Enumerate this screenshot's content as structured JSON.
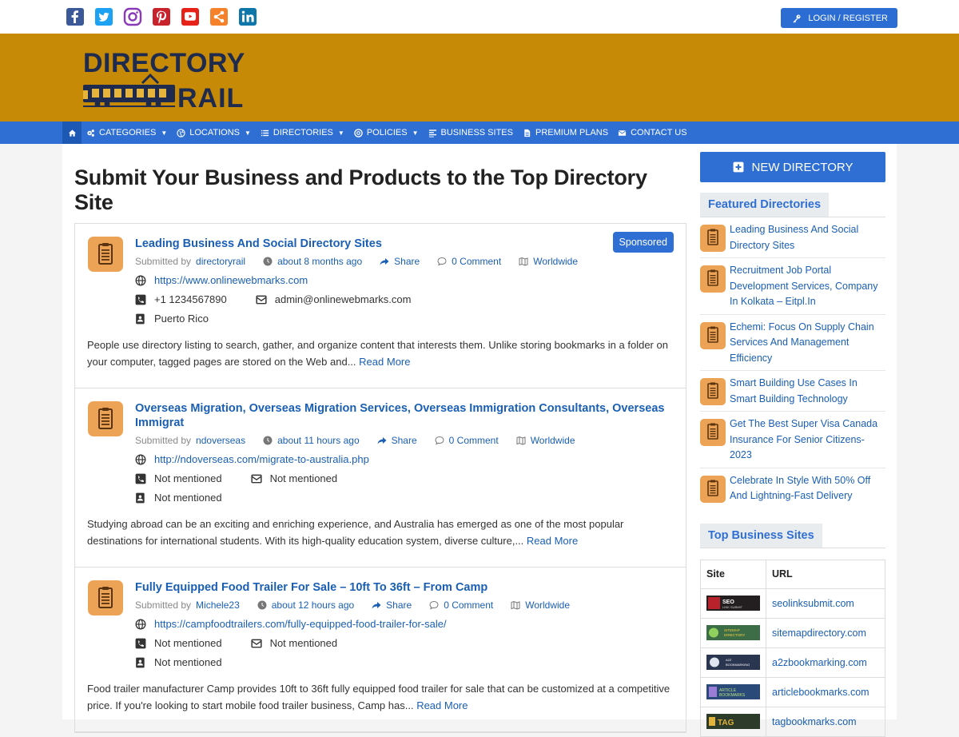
{
  "topbar": {
    "social": [
      "facebook-icon",
      "twitter-icon",
      "instagram-icon",
      "pinterest-icon",
      "youtube-icon",
      "share-icon",
      "linkedin-icon"
    ],
    "login_label": "LOGIN / REGISTER"
  },
  "logo": {
    "line1": "DIRECTORY",
    "line2": "RAIL"
  },
  "nav": {
    "items": [
      {
        "label": "CATEGORIES",
        "dropdown": true
      },
      {
        "label": "LOCATIONS",
        "dropdown": true
      },
      {
        "label": "DIRECTORIES",
        "dropdown": true
      },
      {
        "label": "POLICIES",
        "dropdown": true
      },
      {
        "label": "BUSINESS SITES",
        "dropdown": false
      },
      {
        "label": "PREMIUM PLANS",
        "dropdown": false
      },
      {
        "label": "CONTACT US",
        "dropdown": false
      }
    ]
  },
  "page": {
    "title": "Submit Your Business and Products to the Top Directory Site"
  },
  "listings": [
    {
      "title": "Leading Business And Social Directory Sites",
      "submitted_by_label": "Submitted by",
      "user": "directoryrail",
      "time": "about 8 months ago",
      "share": "Share",
      "comments": "0 Comment",
      "region": "Worldwide",
      "url": "https://www.onlinewebmarks.com",
      "phone": "+1 1234567890",
      "email": "admin@onlinewebmarks.com",
      "location": "Puerto Rico",
      "description": "People use directory listing to search, gather, and organize content that interests them. Unlike storing bookmarks in a folder on your computer, tagged pages are stored on the Web and...",
      "read_more": "Read More",
      "badge": "Sponsored"
    },
    {
      "title": "Overseas Migration, Overseas Migration Services, Overseas Immigration Consultants, Overseas Immigrat",
      "submitted_by_label": "Submitted by",
      "user": "ndoverseas",
      "time": "about 11 hours ago",
      "share": "Share",
      "comments": "0 Comment",
      "region": "Worldwide",
      "url": "http://ndoverseas.com/migrate-to-australia.php",
      "phone": "Not mentioned",
      "email": "Not mentioned",
      "location": "Not mentioned",
      "description": "Studying abroad can be an exciting and enriching experience, and Australia has emerged as one of the most popular destinations for international students. With its high-quality education system, diverse culture,...",
      "read_more": "Read More",
      "badge": ""
    },
    {
      "title": "Fully Equipped Food Trailer For Sale – 10ft To 36ft – From Camp",
      "submitted_by_label": "Submitted by",
      "user": "Michele23",
      "time": "about 12 hours ago",
      "share": "Share",
      "comments": "0 Comment",
      "region": "Worldwide",
      "url": "https://campfoodtrailers.com/fully-equipped-food-trailer-for-sale/",
      "phone": "Not mentioned",
      "email": "Not mentioned",
      "location": "Not mentioned",
      "description": "Food trailer manufacturer Camp provides 10ft to 36ft fully equipped food trailer for sale that can be customized at a competitive price. If you're looking to start mobile food trailer business, Camp has...",
      "read_more": "Read More",
      "badge": ""
    }
  ],
  "sidebar": {
    "new_directory": "NEW DIRECTORY",
    "featured_title": "Featured Directories",
    "featured": [
      "Leading Business And Social Directory Sites",
      "Recruitment Job Portal Development Services, Company In Kolkata – Eitpl.In",
      "Echemi: Focus On Supply Chain Services And Management Efficiency",
      "Smart Building Use Cases In Smart Building Technology",
      "Get The Best Super Visa Canada Insurance For Senior Citizens-2023",
      "Celebrate In Style With 50% Off And Lightning-Fast Delivery"
    ],
    "top_sites_title": "Top Business Sites",
    "table_headers": {
      "site": "Site",
      "url": "URL"
    },
    "top_sites": [
      {
        "logo_text": "SEO LINK SUBMIT",
        "url": "seolinksubmit.com",
        "color": "#b8232b"
      },
      {
        "logo_text": "SITEMAP DIRECTORY",
        "url": "sitemapdirectory.com",
        "color": "#3c6d46"
      },
      {
        "logo_text": "A2Z BOOKMARKING",
        "url": "a2zbookmarking.com",
        "color": "#2a3550"
      },
      {
        "logo_text": "ARTICLE BOOKMARKS",
        "url": "articlebookmarks.com",
        "color": "#2a4b7a"
      },
      {
        "logo_text": "TAG",
        "url": "tagbookmarks.com",
        "color": "#2d3b2a"
      }
    ]
  },
  "colors": {
    "brand_blue": "#2f6fd4",
    "banner": "#c78a06",
    "link": "#1a5fb4",
    "icon_orange": "#eda356"
  }
}
